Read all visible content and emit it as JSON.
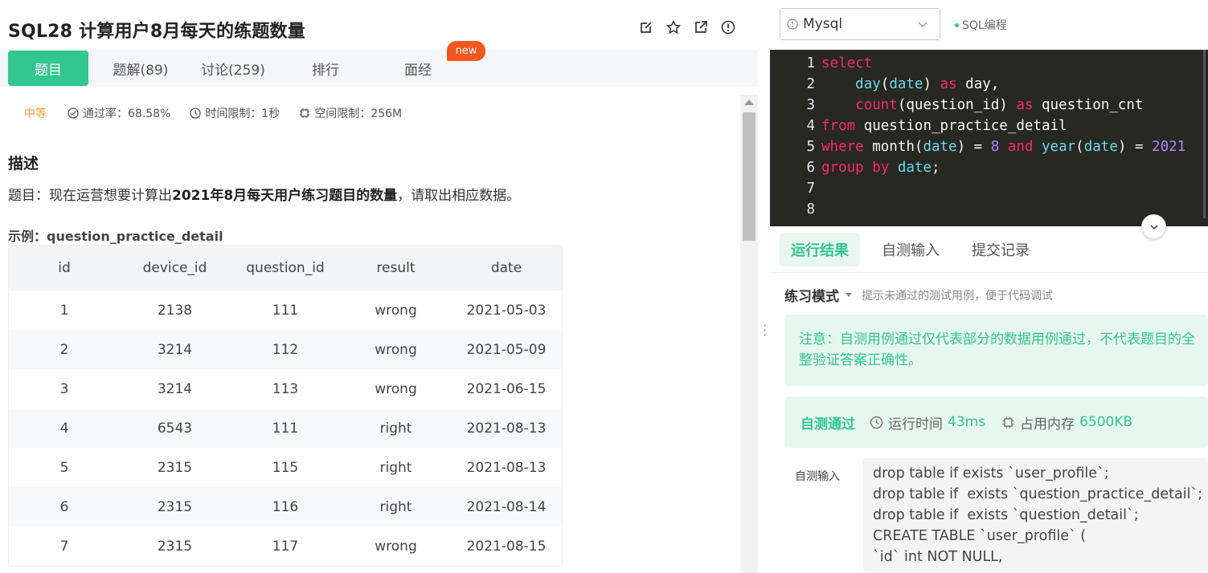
{
  "problem": {
    "title": "SQL28  计算用户8月每天的练题数量",
    "icons": [
      "edit-icon",
      "star-icon",
      "external-link-icon",
      "info-icon"
    ],
    "tabs": [
      {
        "label": "题目",
        "active": true
      },
      {
        "label": "题解(89)"
      },
      {
        "label": "讨论(259)"
      },
      {
        "label": "排行"
      },
      {
        "label": "面经"
      }
    ],
    "new_badge": "new",
    "difficulty": "中等",
    "pass_rate": "通过率：68.58%",
    "time_limit": "时间限制：1秒",
    "space_limit": "空间限制：256M",
    "desc_heading": "描述",
    "desc_prefix": "题目：现在运营想要计算出",
    "desc_bold": "2021年8月每天用户练习题目的数量",
    "desc_suffix": "，请取出相应数据。",
    "example_label": "示例：question_practice_detail",
    "table": {
      "headers": [
        "id",
        "device_id",
        "question_id",
        "result",
        "date"
      ],
      "rows": [
        [
          "1",
          "2138",
          "111",
          "wrong",
          "2021-05-03"
        ],
        [
          "2",
          "3214",
          "112",
          "wrong",
          "2021-05-09"
        ],
        [
          "3",
          "3214",
          "113",
          "wrong",
          "2021-06-15"
        ],
        [
          "4",
          "6543",
          "111",
          "right",
          "2021-08-13"
        ],
        [
          "5",
          "2315",
          "115",
          "right",
          "2021-08-13"
        ],
        [
          "6",
          "2315",
          "116",
          "right",
          "2021-08-14"
        ],
        [
          "7",
          "2315",
          "117",
          "wrong",
          "2021-08-15"
        ]
      ]
    }
  },
  "editor": {
    "language": "Mysql",
    "mode_tag": "SQL编程",
    "line_numbers": [
      "1",
      "2",
      "3",
      "4",
      "5",
      "6",
      "7",
      "8"
    ]
  },
  "results": {
    "tabs": [
      "运行结果",
      "自测输入",
      "提交记录"
    ],
    "mode": "练习模式",
    "mode_hint": "提示未通过的测试用例，便于代码调试",
    "notice_line1": "注意：自测用例通过仅代表部分的数据用例通过，不代表题目的全",
    "notice_line2": "整验证答案正确性。",
    "pass_status": "自测通过",
    "runtime_label": "运行时间",
    "runtime_value": "43ms",
    "memory_label": "占用内存",
    "memory_value": "6500KB",
    "self_input_label": "自测输入",
    "self_input_text": "drop table if exists `user_profile`;\ndrop table if  exists `question_practice_detail`;\ndrop table if  exists `question_detail`;\nCREATE TABLE `user_profile` (\n`id` int NOT NULL,"
  },
  "colors": {
    "accent": "#32c690",
    "badge": "#f5561e",
    "difficulty": "#f0a020",
    "editor_bg": "#272822"
  }
}
